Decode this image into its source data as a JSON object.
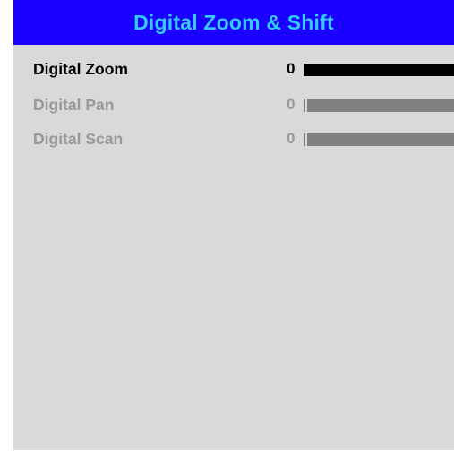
{
  "window": {
    "title": "Digital Zoom & Shift"
  },
  "colors": {
    "title_bar_bg": "#1a00ff",
    "title_text": "#33ccff",
    "panel_bg": "#d9d9d9",
    "active_text": "#000000",
    "inactive_text": "#999999",
    "active_bar": "#000000",
    "inactive_bar": "#808080"
  },
  "menu": {
    "items": [
      {
        "label": "Digital Zoom",
        "value": "0",
        "state": "selected"
      },
      {
        "label": "Digital Pan",
        "value": "0",
        "state": "disabled"
      },
      {
        "label": "Digital Scan",
        "value": "0",
        "state": "disabled"
      }
    ]
  }
}
